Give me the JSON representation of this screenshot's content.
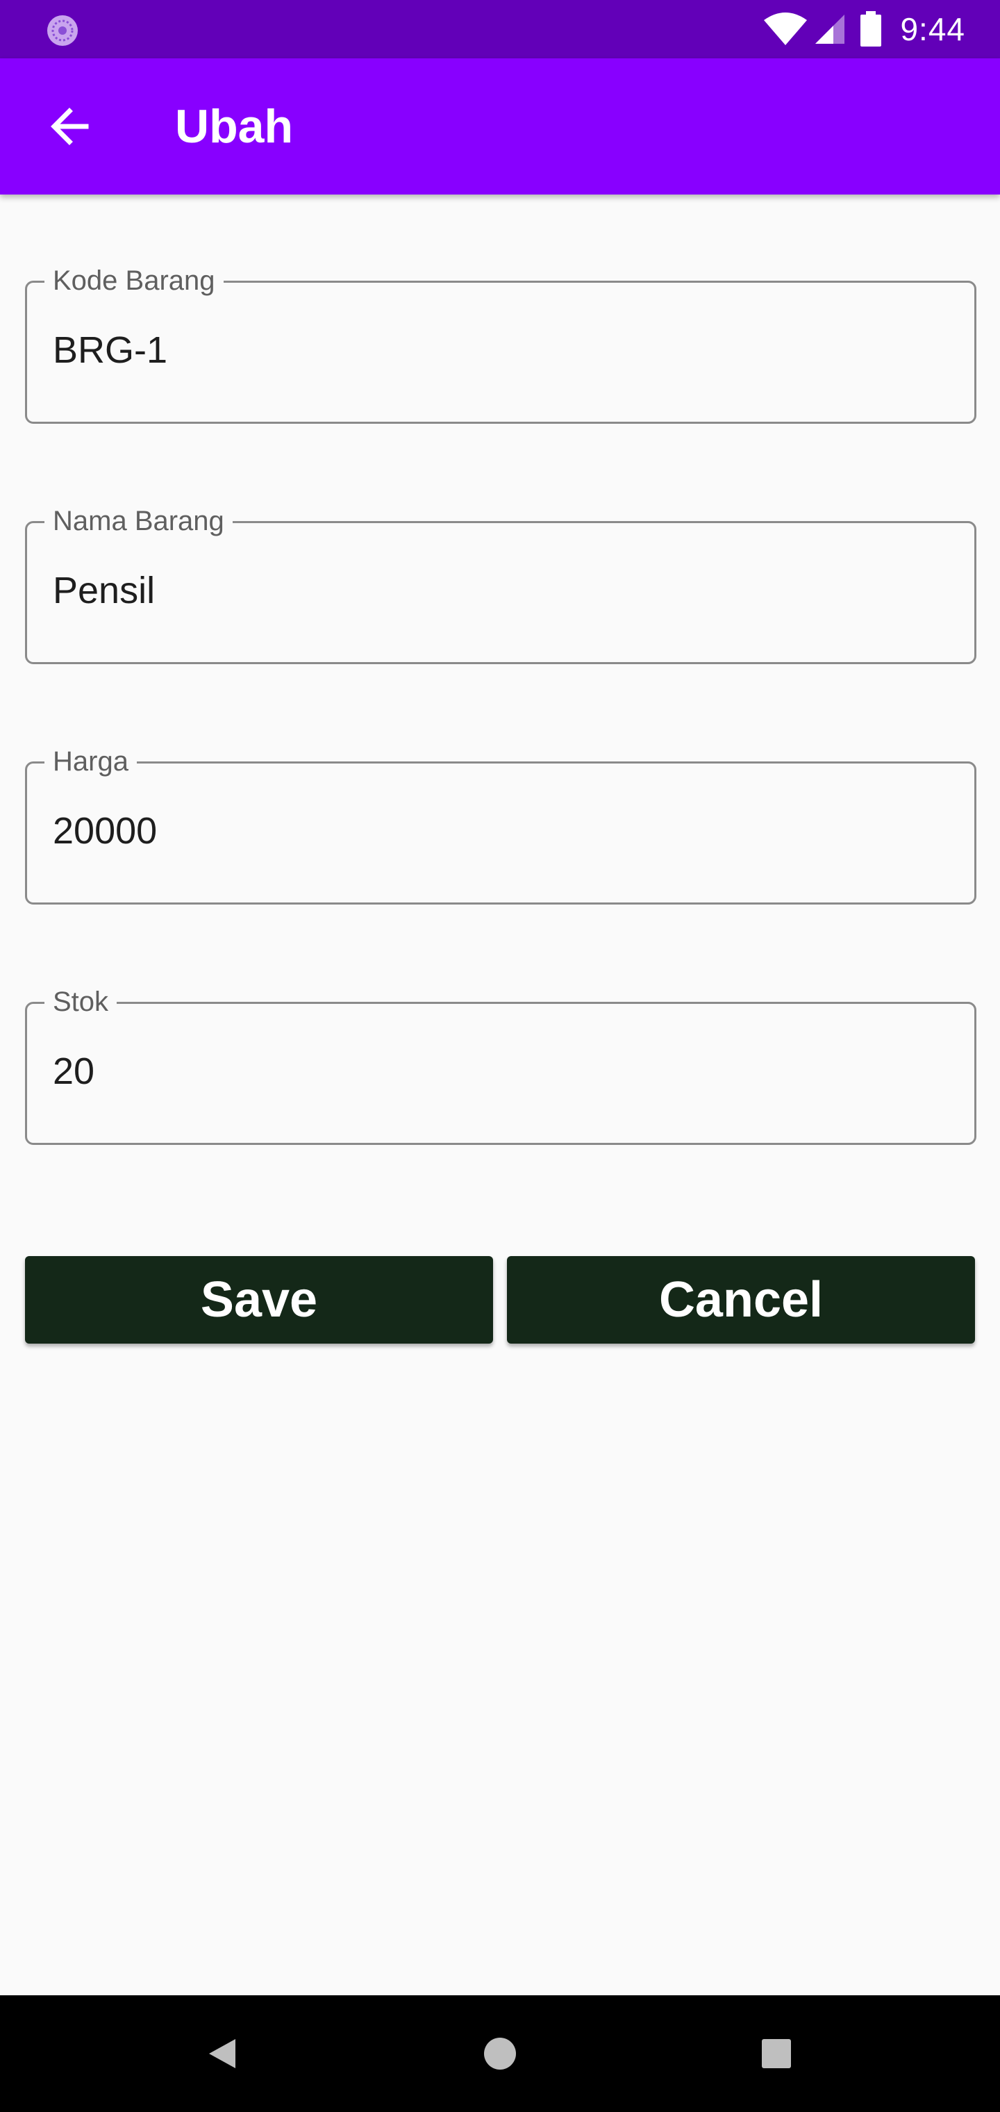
{
  "status_bar": {
    "time": "9:44",
    "icons": [
      "app-notification-icon",
      "wifi-icon",
      "cell-signal-icon",
      "battery-icon"
    ]
  },
  "app_bar": {
    "title": "Ubah",
    "back_icon": "arrow-left-icon"
  },
  "form": {
    "fields": [
      {
        "label": "Kode Barang",
        "value": "BRG-1"
      },
      {
        "label": "Nama Barang",
        "value": "Pensil"
      },
      {
        "label": "Harga",
        "value": "20000"
      },
      {
        "label": "Stok",
        "value": "20"
      }
    ]
  },
  "buttons": {
    "save_label": "Save",
    "cancel_label": "Cancel"
  },
  "nav_bar": {
    "icons": [
      "nav-back-icon",
      "nav-home-icon",
      "nav-recents-icon"
    ]
  },
  "colors": {
    "status_bar": "#6200b8",
    "app_bar": "#8800ff",
    "button": "#142818",
    "background": "#fafafa"
  }
}
